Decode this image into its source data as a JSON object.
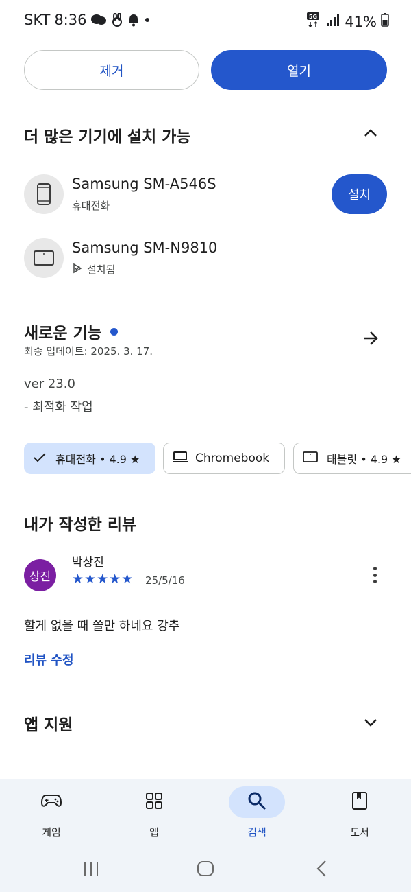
{
  "status_bar": {
    "carrier": "SKT",
    "time": "8:36",
    "network": "5G",
    "battery": "41%"
  },
  "actions": {
    "remove_label": "제거",
    "open_label": "열기"
  },
  "more_devices": {
    "title": "더 많은 기기에 설치 가능",
    "devices": [
      {
        "name": "Samsung SM-A546S",
        "type": "휴대전화",
        "action": "설치",
        "icon": "phone-icon"
      },
      {
        "name": "Samsung SM-N9810",
        "type": "설치됨",
        "icon": "tablet-icon"
      }
    ]
  },
  "whats_new": {
    "title": "새로운 기능",
    "updated": "최종 업데이트: 2025. 3. 17.",
    "version": "ver 23.0",
    "note": "- 최적화 작업"
  },
  "chips": [
    {
      "label": "휴대전화 • 4.9 ★",
      "icon": "check-icon",
      "selected": true
    },
    {
      "label": "Chromebook",
      "icon": "laptop-icon",
      "selected": false
    },
    {
      "label": "태블릿 • 4.9 ★",
      "icon": "tablet-icon",
      "selected": false
    }
  ],
  "my_review": {
    "title": "내가 작성한 리뷰",
    "avatar_text": "상진",
    "reviewer": "박상진",
    "stars": "★★★★★",
    "rating": 5,
    "date": "25/5/16",
    "text": "할게 없을 때 쓸만 하네요 강추",
    "edit_label": "리뷰 수정"
  },
  "app_support": {
    "title": "앱 지원"
  },
  "bottom_nav": [
    {
      "label": "게임",
      "icon": "gamepad-icon",
      "active": false
    },
    {
      "label": "앱",
      "icon": "apps-grid-icon",
      "active": false
    },
    {
      "label": "검색",
      "icon": "search-icon",
      "active": true
    },
    {
      "label": "도서",
      "icon": "book-icon",
      "active": false
    }
  ],
  "colors": {
    "accent": "#2457cc",
    "chip_selected": "#d3e3fd",
    "avatar": "#7b1fa2",
    "nav_bg": "#f0f4f9"
  }
}
